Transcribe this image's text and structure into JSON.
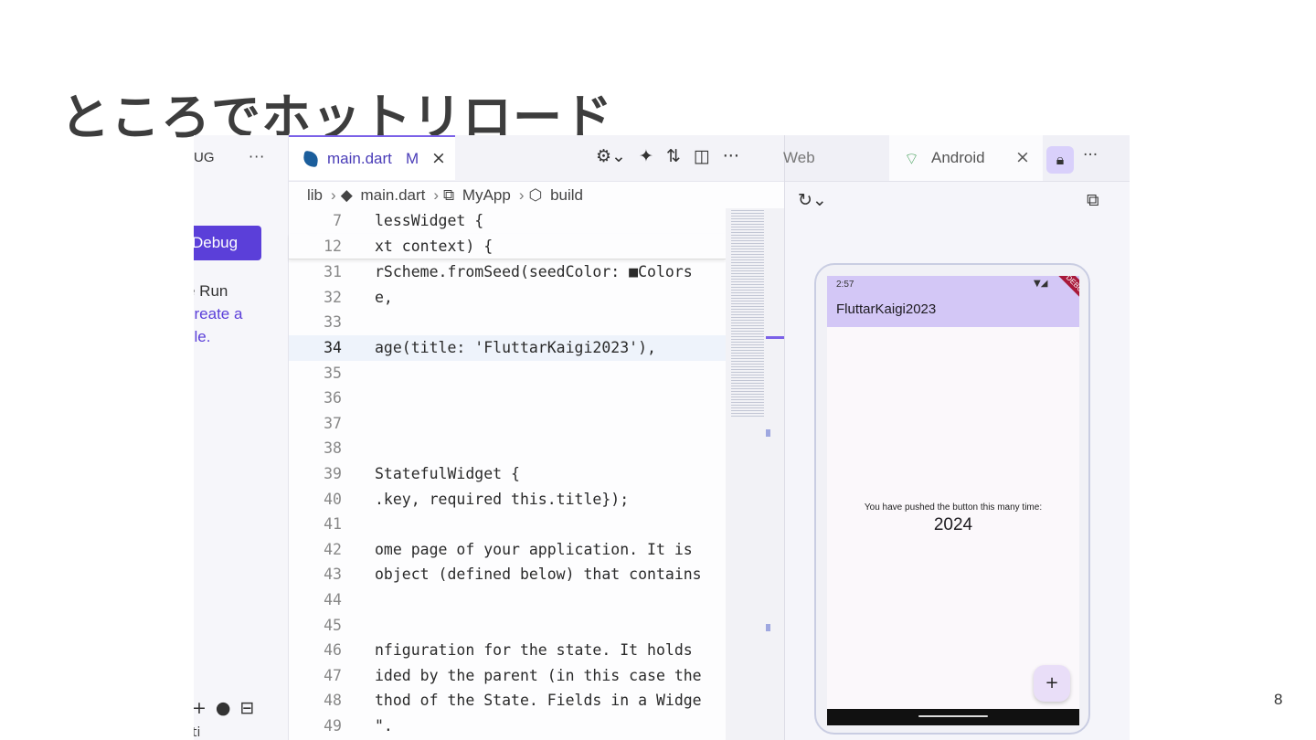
{
  "slide": {
    "title": "ところでホットリロード",
    "page_number": "8"
  },
  "debug_panel": {
    "header": "UG",
    "menu": "···",
    "button_label": "Debug",
    "text_line1": "e Run",
    "link_line1": "create a",
    "link_line2": "file.",
    "footer": "ti"
  },
  "editor": {
    "tab": {
      "filename": "main.dart",
      "status": "M",
      "close": "×"
    },
    "toolbar_menu": "···",
    "breadcrumb": {
      "folder": "lib",
      "file": "main.dart",
      "class": "MyApp",
      "method": "build"
    },
    "lines": [
      {
        "num": "7",
        "code": "lessWidget {"
      },
      {
        "num": "12",
        "code": "xt context) {"
      },
      {
        "num": "31",
        "code": "rScheme.fromSeed(seedColor: ■Colors"
      },
      {
        "num": "32",
        "code": "e,"
      },
      {
        "num": "33",
        "code": ""
      },
      {
        "num": "34",
        "code": "age(title: 'FluttarKaigi2023'),"
      },
      {
        "num": "35",
        "code": ""
      },
      {
        "num": "36",
        "code": ""
      },
      {
        "num": "37",
        "code": ""
      },
      {
        "num": "38",
        "code": ""
      },
      {
        "num": "39",
        "code": "StatefulWidget {"
      },
      {
        "num": "40",
        "code": ".key, required this.title});"
      },
      {
        "num": "41",
        "code": ""
      },
      {
        "num": "42",
        "code": "ome page of your application. It is"
      },
      {
        "num": "43",
        "code": "object (defined below) that contains"
      },
      {
        "num": "44",
        "code": ""
      },
      {
        "num": "45",
        "code": ""
      },
      {
        "num": "46",
        "code": "nfiguration for the state. It holds"
      },
      {
        "num": "47",
        "code": "ided by the parent (in this case the"
      },
      {
        "num": "48",
        "code": "thod of the State. Fields in a Widge"
      },
      {
        "num": "49",
        "code": "\"."
      }
    ]
  },
  "preview": {
    "tab_web": "Web",
    "tab_android": "Android",
    "close": "×",
    "menu": "···",
    "phone": {
      "status_time": "2:57",
      "app_title": "FluttarKaigi2023",
      "debug_banner": "DEBUG",
      "message": "You have pushed the button this many time:",
      "counter": "2024",
      "fab_label": "+"
    }
  }
}
